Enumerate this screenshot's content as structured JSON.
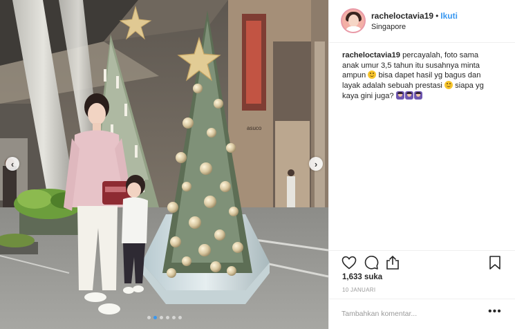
{
  "post": {
    "username": "racheloctavia19",
    "follow_label": "Ikuti",
    "bullet": "•",
    "location": "Singapore",
    "caption": {
      "username": "racheloctavia19",
      "part1": "percayalah, foto sama anak umur 3,5 tahun itu susahnya minta ampun",
      "part2": "bisa dapet hasil yg bagus dan layak adalah sebuah prestasi",
      "part3": "siapa yg kaya gini juga?",
      "emojis": [
        "smile",
        "smile",
        "facepalm",
        "facepalm",
        "facepalm"
      ]
    },
    "likes_label": "1,633 suka",
    "date_label": "10 JANUARI",
    "comment_placeholder": "Tambahkan komentar...",
    "more_options_label": "•••"
  },
  "photo": {
    "store_sign": "asuco",
    "prev_arrow": "‹",
    "next_arrow": "›",
    "carousel_dot_count": 6,
    "active_dot_index": 1
  },
  "icons": [
    "heart-icon",
    "comment-icon",
    "share-icon",
    "bookmark-icon",
    "chevron-left-icon",
    "chevron-right-icon"
  ],
  "colors": {
    "link_blue": "#3897f0",
    "text": "#262626",
    "muted": "#999999",
    "border": "#efefef"
  }
}
